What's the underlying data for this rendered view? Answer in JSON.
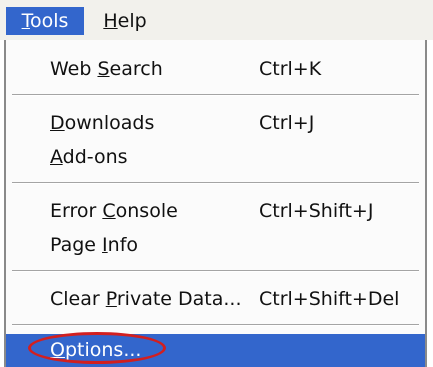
{
  "menubar": {
    "tools": {
      "label": "Tools",
      "mnemonic": "T",
      "rest": "ools"
    },
    "help": {
      "label": "Help",
      "mnemonic": "H",
      "rest": "elp"
    }
  },
  "menu": {
    "items": [
      {
        "label": "Web Search",
        "pre": "Web ",
        "mnemonic": "S",
        "post": "earch",
        "shortcut": "Ctrl+K"
      },
      {
        "label": "Downloads",
        "pre": "",
        "mnemonic": "D",
        "post": "ownloads",
        "shortcut": "Ctrl+J"
      },
      {
        "label": "Add-ons",
        "pre": "",
        "mnemonic": "A",
        "post": "dd-ons",
        "shortcut": ""
      },
      {
        "label": "Error Console",
        "pre": "Error ",
        "mnemonic": "C",
        "post": "onsole",
        "shortcut": "Ctrl+Shift+J"
      },
      {
        "label": "Page Info",
        "pre": "Page ",
        "mnemonic": "I",
        "post": "nfo",
        "shortcut": ""
      },
      {
        "label": "Clear Private Data...",
        "pre": "Clear ",
        "mnemonic": "P",
        "post": "rivate Data...",
        "shortcut": "Ctrl+Shift+Del"
      },
      {
        "label": "Options...",
        "pre": "",
        "mnemonic": "O",
        "post": "ptions...",
        "shortcut": ""
      }
    ]
  },
  "colors": {
    "highlight": "#3366cc",
    "callout": "#d21f1f",
    "menubar": "#f2f1ec"
  }
}
